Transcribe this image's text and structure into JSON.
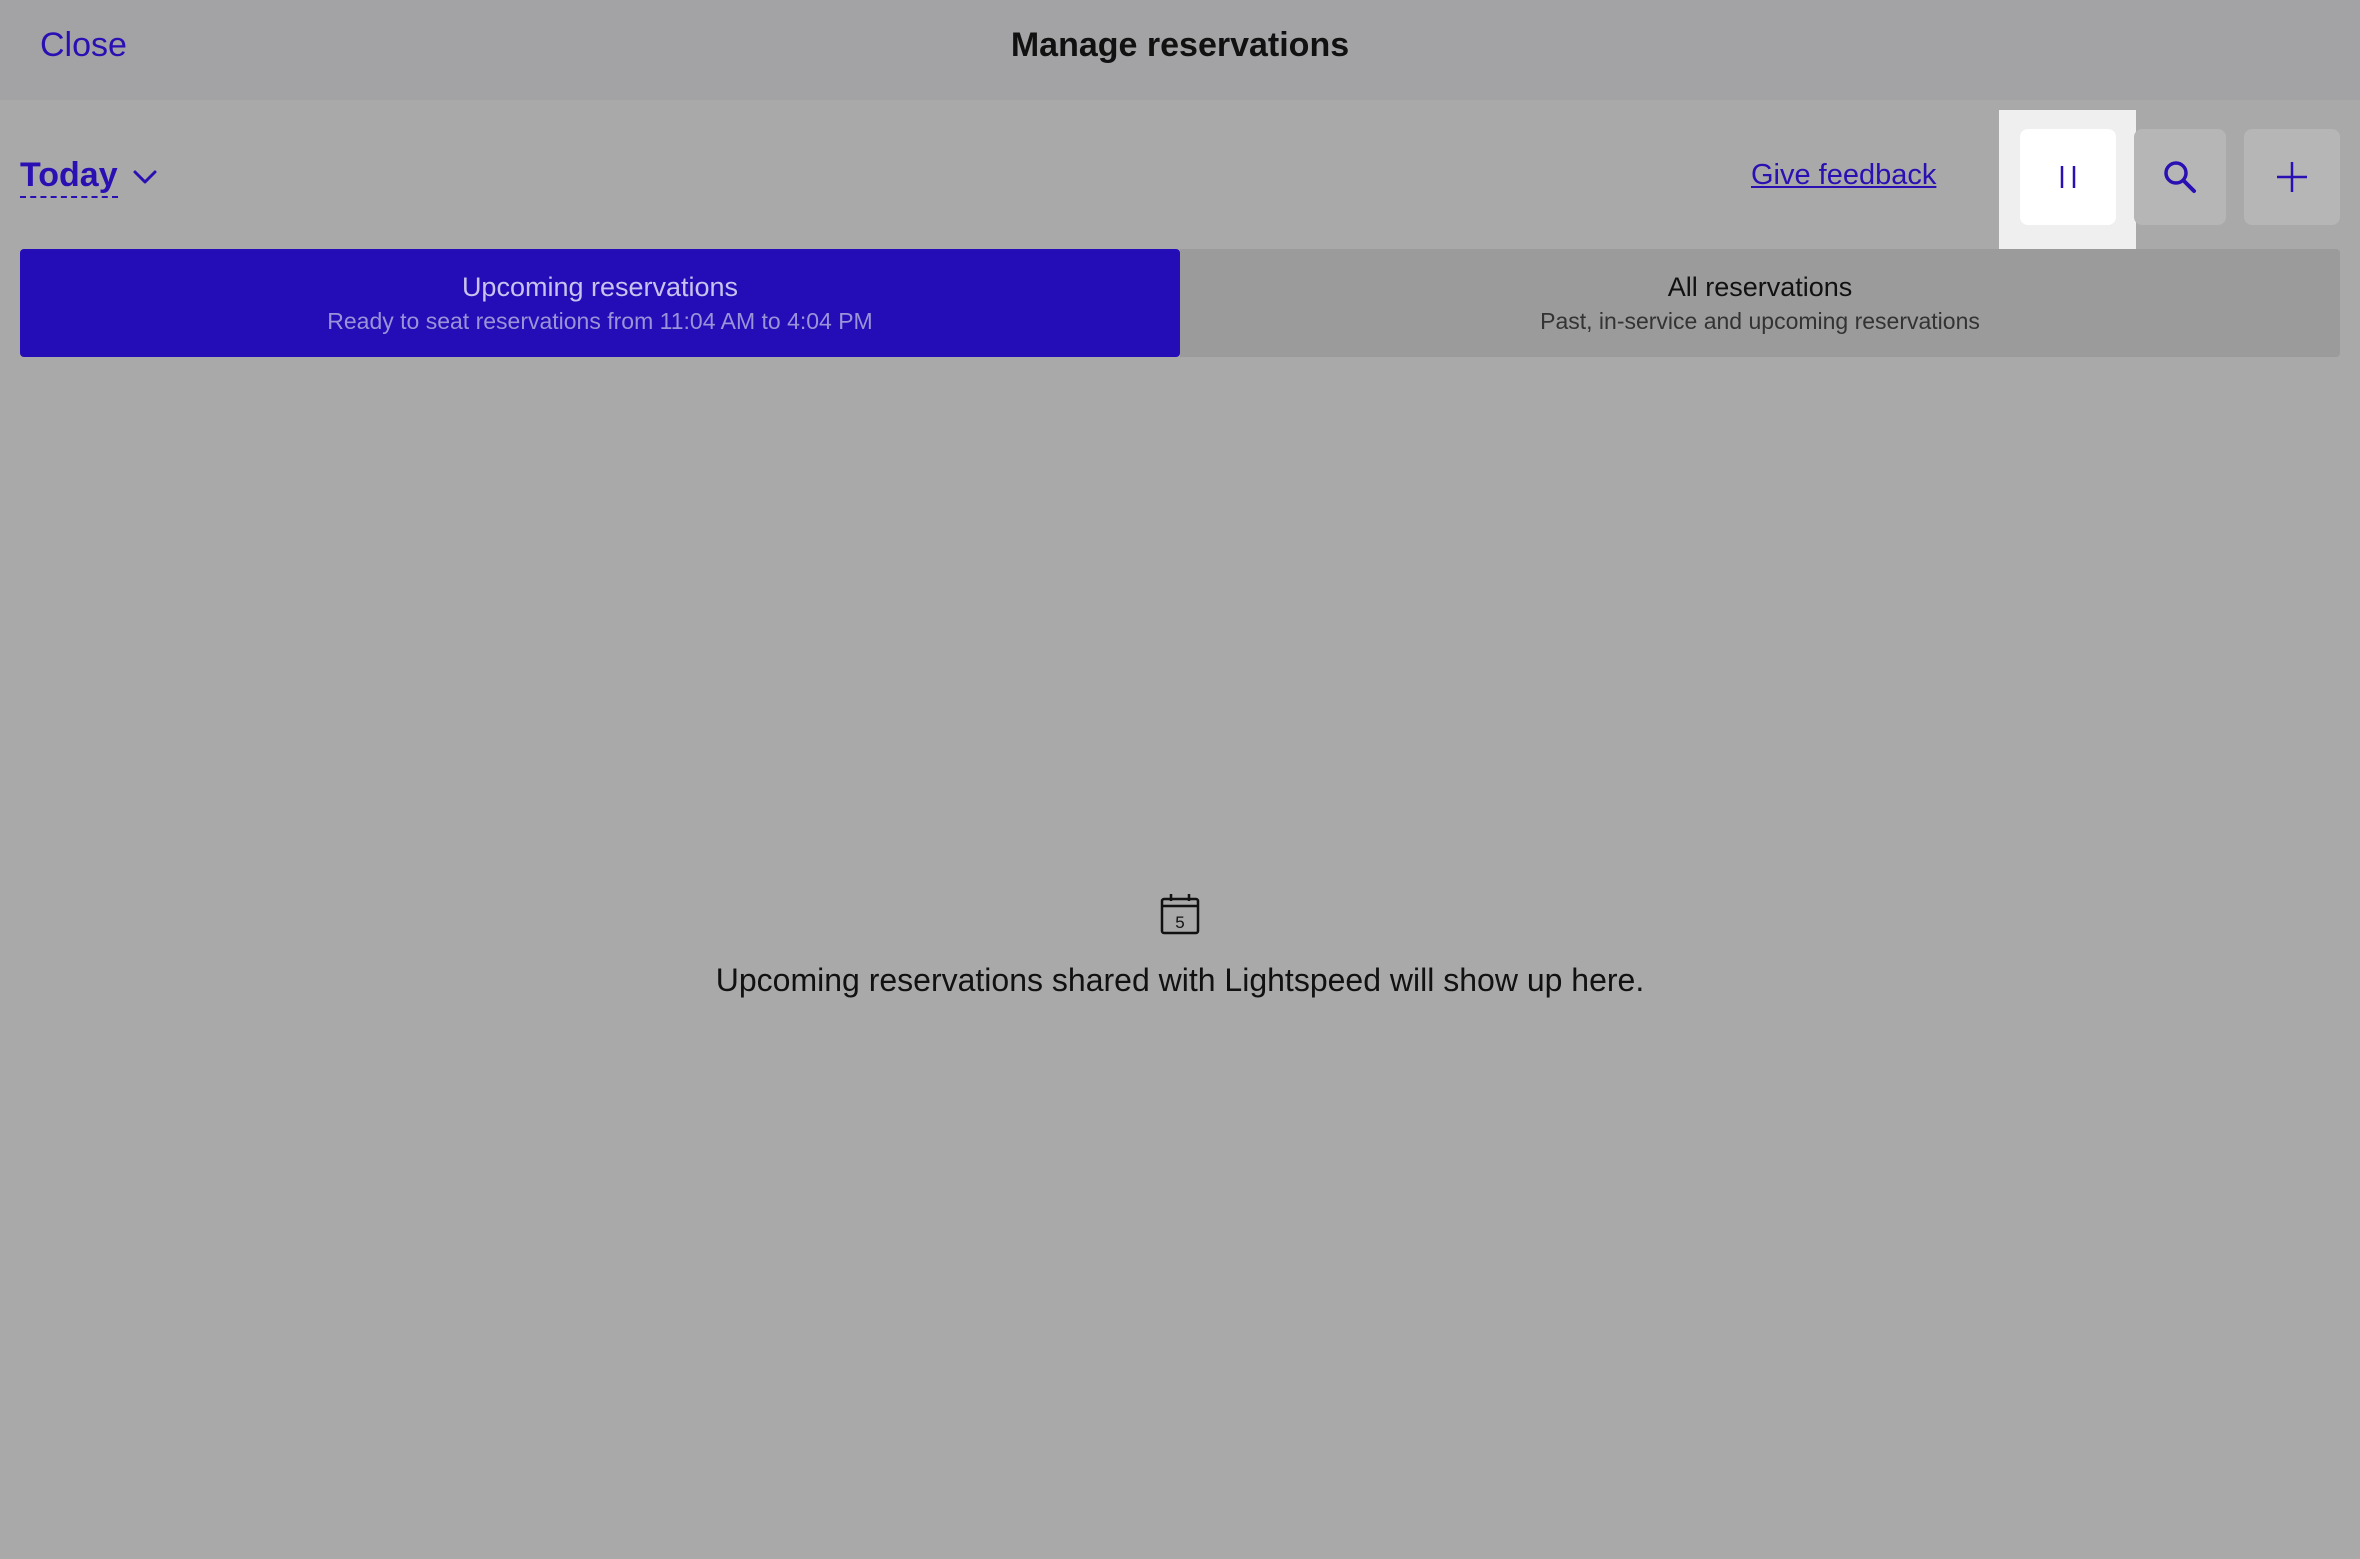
{
  "header": {
    "close_label": "Close",
    "title": "Manage reservations"
  },
  "toolbar": {
    "date_filter": "Today",
    "feedback_label": "Give feedback",
    "icons": [
      "pause-icon",
      "search-icon",
      "plus-icon"
    ]
  },
  "tabs": [
    {
      "title": "Upcoming reservations",
      "subtitle": "Ready to seat reservations from 11:04 AM to 4:04 PM",
      "active": true
    },
    {
      "title": "All reservations",
      "subtitle": "Past, in-service and upcoming reservations",
      "active": false
    }
  ],
  "empty_state": {
    "icon": "calendar-icon",
    "calendar_day": "5",
    "message": "Upcoming reservations shared with Lightspeed will show up here."
  },
  "colors": {
    "accent": "#2a0fb3",
    "active_tab": "#240cb6",
    "background": "#a9a9a9"
  }
}
